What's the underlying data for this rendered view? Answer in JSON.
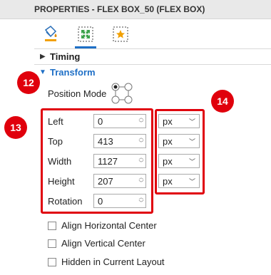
{
  "header": {
    "title": "PROPERTIES - FLEX BOX_50 (FLEX BOX)"
  },
  "tabs": [
    {
      "icon": "paint-bucket-icon"
    },
    {
      "icon": "move-icon"
    },
    {
      "icon": "star-frame-icon"
    }
  ],
  "sections": {
    "timing": "Timing",
    "transform": "Transform"
  },
  "position_mode": {
    "label": "Position Mode"
  },
  "fields": {
    "left": {
      "label": "Left",
      "value": "0",
      "unit": "px"
    },
    "top": {
      "label": "Top",
      "value": "413",
      "unit": "px"
    },
    "width": {
      "label": "Width",
      "value": "1127",
      "unit": "px"
    },
    "height": {
      "label": "Height",
      "value": "207",
      "unit": "px"
    },
    "rotation": {
      "label": "Rotation",
      "value": "0"
    }
  },
  "callouts": {
    "c12": "12",
    "c13": "13",
    "c14": "14"
  },
  "checkboxes": {
    "align_h": "Align Horizontal Center",
    "align_v": "Align Vertical Center",
    "hidden": "Hidden in Current Layout"
  },
  "colors": {
    "accent": "#1e6fc6",
    "callout": "#e0000c"
  }
}
